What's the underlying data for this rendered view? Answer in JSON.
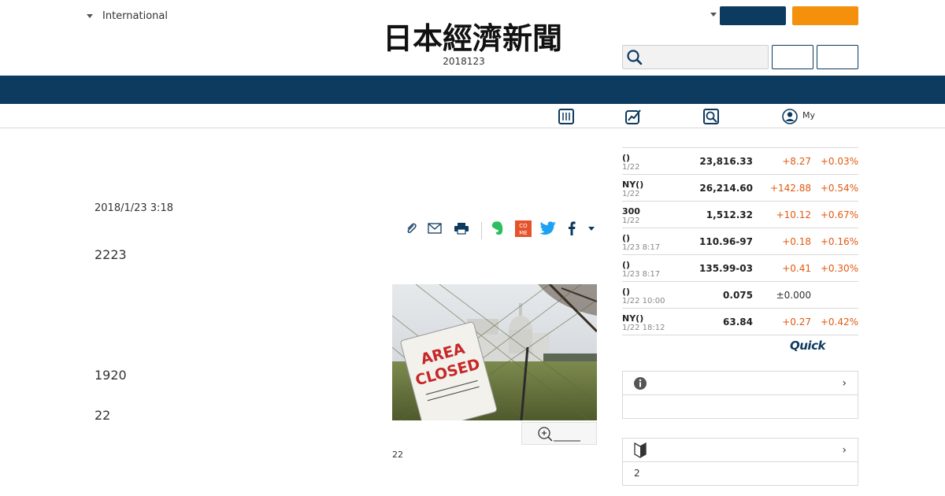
{
  "header": {
    "region_label": "International",
    "logo_text": "日本經濟新聞",
    "edition": "2018123",
    "search": {
      "placeholder": "",
      "value": ""
    },
    "nav_links": [
      ""
    ],
    "subnav": {
      "my_label": "My"
    }
  },
  "article": {
    "dateline": "2018/1/23 3:18",
    "paragraphs": [
      "2223",
      "1920",
      "22"
    ],
    "photo_sign_text": "AREA CLOSED",
    "photo_caption": "22"
  },
  "market": {
    "rows": [
      {
        "name": "()",
        "date": "1/22",
        "value": "23,816.33",
        "change": "+8.27",
        "pct": "+0.03%"
      },
      {
        "name": "NY()",
        "date": "1/22",
        "value": "26,214.60",
        "change": "+142.88",
        "pct": "+0.54%"
      },
      {
        "name": "300",
        "date": "1/22",
        "value": "1,512.32",
        "change": "+10.12",
        "pct": "+0.67%"
      },
      {
        "name": "()",
        "date": "1/23 8:17",
        "value": "110.96-97",
        "change": "+0.18",
        "pct": "+0.16%"
      },
      {
        "name": "()",
        "date": "1/23 8:17",
        "value": "135.99-03",
        "change": "+0.41",
        "pct": "+0.30%"
      },
      {
        "name": "()",
        "date": "1/22 10:00",
        "value": "0.075",
        "change": "±0.000",
        "pct": ""
      },
      {
        "name": "NY()",
        "date": "1/22 18:12",
        "value": "63.84",
        "change": "+0.27",
        "pct": "+0.42%"
      }
    ],
    "provider": "Quick"
  },
  "side_boxes": [
    {
      "icon": "info-icon",
      "body": ""
    },
    {
      "icon": "beginner-mark-icon",
      "body": "2"
    }
  ],
  "colors": {
    "navy": "#0d3a5f",
    "orange": "#f5900c",
    "positive": "#e05a10"
  }
}
